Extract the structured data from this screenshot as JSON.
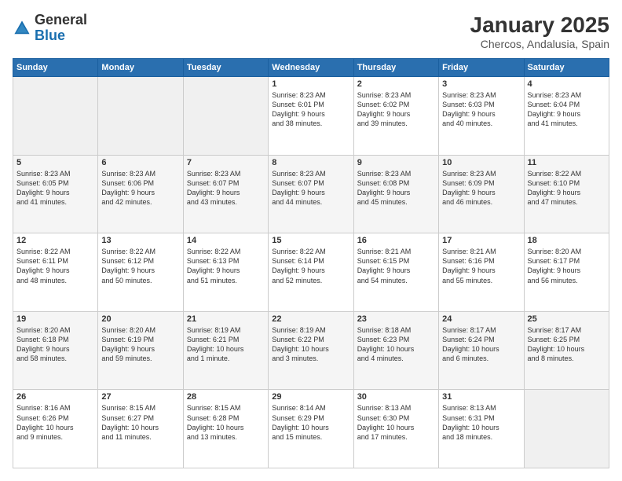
{
  "header": {
    "logo_general": "General",
    "logo_blue": "Blue",
    "month_title": "January 2025",
    "location": "Chercos, Andalusia, Spain"
  },
  "days_of_week": [
    "Sunday",
    "Monday",
    "Tuesday",
    "Wednesday",
    "Thursday",
    "Friday",
    "Saturday"
  ],
  "weeks": [
    {
      "days": [
        {
          "num": "",
          "info": ""
        },
        {
          "num": "",
          "info": ""
        },
        {
          "num": "",
          "info": ""
        },
        {
          "num": "1",
          "info": "Sunrise: 8:23 AM\nSunset: 6:01 PM\nDaylight: 9 hours\nand 38 minutes."
        },
        {
          "num": "2",
          "info": "Sunrise: 8:23 AM\nSunset: 6:02 PM\nDaylight: 9 hours\nand 39 minutes."
        },
        {
          "num": "3",
          "info": "Sunrise: 8:23 AM\nSunset: 6:03 PM\nDaylight: 9 hours\nand 40 minutes."
        },
        {
          "num": "4",
          "info": "Sunrise: 8:23 AM\nSunset: 6:04 PM\nDaylight: 9 hours\nand 41 minutes."
        }
      ]
    },
    {
      "days": [
        {
          "num": "5",
          "info": "Sunrise: 8:23 AM\nSunset: 6:05 PM\nDaylight: 9 hours\nand 41 minutes."
        },
        {
          "num": "6",
          "info": "Sunrise: 8:23 AM\nSunset: 6:06 PM\nDaylight: 9 hours\nand 42 minutes."
        },
        {
          "num": "7",
          "info": "Sunrise: 8:23 AM\nSunset: 6:07 PM\nDaylight: 9 hours\nand 43 minutes."
        },
        {
          "num": "8",
          "info": "Sunrise: 8:23 AM\nSunset: 6:07 PM\nDaylight: 9 hours\nand 44 minutes."
        },
        {
          "num": "9",
          "info": "Sunrise: 8:23 AM\nSunset: 6:08 PM\nDaylight: 9 hours\nand 45 minutes."
        },
        {
          "num": "10",
          "info": "Sunrise: 8:23 AM\nSunset: 6:09 PM\nDaylight: 9 hours\nand 46 minutes."
        },
        {
          "num": "11",
          "info": "Sunrise: 8:22 AM\nSunset: 6:10 PM\nDaylight: 9 hours\nand 47 minutes."
        }
      ]
    },
    {
      "days": [
        {
          "num": "12",
          "info": "Sunrise: 8:22 AM\nSunset: 6:11 PM\nDaylight: 9 hours\nand 48 minutes."
        },
        {
          "num": "13",
          "info": "Sunrise: 8:22 AM\nSunset: 6:12 PM\nDaylight: 9 hours\nand 50 minutes."
        },
        {
          "num": "14",
          "info": "Sunrise: 8:22 AM\nSunset: 6:13 PM\nDaylight: 9 hours\nand 51 minutes."
        },
        {
          "num": "15",
          "info": "Sunrise: 8:22 AM\nSunset: 6:14 PM\nDaylight: 9 hours\nand 52 minutes."
        },
        {
          "num": "16",
          "info": "Sunrise: 8:21 AM\nSunset: 6:15 PM\nDaylight: 9 hours\nand 54 minutes."
        },
        {
          "num": "17",
          "info": "Sunrise: 8:21 AM\nSunset: 6:16 PM\nDaylight: 9 hours\nand 55 minutes."
        },
        {
          "num": "18",
          "info": "Sunrise: 8:20 AM\nSunset: 6:17 PM\nDaylight: 9 hours\nand 56 minutes."
        }
      ]
    },
    {
      "days": [
        {
          "num": "19",
          "info": "Sunrise: 8:20 AM\nSunset: 6:18 PM\nDaylight: 9 hours\nand 58 minutes."
        },
        {
          "num": "20",
          "info": "Sunrise: 8:20 AM\nSunset: 6:19 PM\nDaylight: 9 hours\nand 59 minutes."
        },
        {
          "num": "21",
          "info": "Sunrise: 8:19 AM\nSunset: 6:21 PM\nDaylight: 10 hours\nand 1 minute."
        },
        {
          "num": "22",
          "info": "Sunrise: 8:19 AM\nSunset: 6:22 PM\nDaylight: 10 hours\nand 3 minutes."
        },
        {
          "num": "23",
          "info": "Sunrise: 8:18 AM\nSunset: 6:23 PM\nDaylight: 10 hours\nand 4 minutes."
        },
        {
          "num": "24",
          "info": "Sunrise: 8:17 AM\nSunset: 6:24 PM\nDaylight: 10 hours\nand 6 minutes."
        },
        {
          "num": "25",
          "info": "Sunrise: 8:17 AM\nSunset: 6:25 PM\nDaylight: 10 hours\nand 8 minutes."
        }
      ]
    },
    {
      "days": [
        {
          "num": "26",
          "info": "Sunrise: 8:16 AM\nSunset: 6:26 PM\nDaylight: 10 hours\nand 9 minutes."
        },
        {
          "num": "27",
          "info": "Sunrise: 8:15 AM\nSunset: 6:27 PM\nDaylight: 10 hours\nand 11 minutes."
        },
        {
          "num": "28",
          "info": "Sunrise: 8:15 AM\nSunset: 6:28 PM\nDaylight: 10 hours\nand 13 minutes."
        },
        {
          "num": "29",
          "info": "Sunrise: 8:14 AM\nSunset: 6:29 PM\nDaylight: 10 hours\nand 15 minutes."
        },
        {
          "num": "30",
          "info": "Sunrise: 8:13 AM\nSunset: 6:30 PM\nDaylight: 10 hours\nand 17 minutes."
        },
        {
          "num": "31",
          "info": "Sunrise: 8:13 AM\nSunset: 6:31 PM\nDaylight: 10 hours\nand 18 minutes."
        },
        {
          "num": "",
          "info": ""
        }
      ]
    }
  ]
}
